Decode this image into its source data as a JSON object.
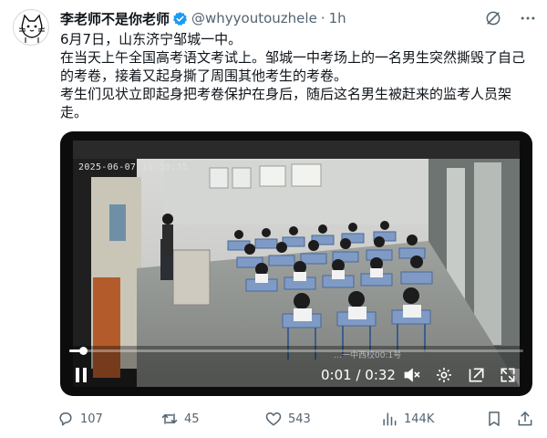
{
  "author": {
    "name": "李老师不是你老师",
    "handle": "@whyyoutouzhele",
    "separator": "·",
    "time": "1h",
    "avatar_icon": "cat-sketch-avatar",
    "verified_icon": "verified-badge-icon",
    "verified_color": "#1d9bf0"
  },
  "body": {
    "lines": [
      "6月7日，山东济宁邹城一中。",
      "在当天上午全国高考语文考试上。邹城一中考场上的一名男生突然撕毁了自己的考卷，接着又起身撕了周围其他考生的考卷。",
      "考生们见状立即起身把考卷保护在身后，随后这名男生被赶来的监考人员架走。"
    ]
  },
  "video": {
    "timestamp": "2025-06-07 10:38:35",
    "watermark": "…一中西校00:1号",
    "current_time": "0:01",
    "duration": "0:32",
    "time_separator": " / ",
    "progress": 0.03
  },
  "actions": {
    "reply": {
      "icon": "reply-icon",
      "count": "107"
    },
    "retweet": {
      "icon": "retweet-icon",
      "count": "45"
    },
    "like": {
      "icon": "heart-icon",
      "count": "543"
    },
    "views": {
      "icon": "views-chart-icon",
      "count": "144K"
    },
    "bookmark": {
      "icon": "bookmark-icon"
    },
    "share": {
      "icon": "share-icon"
    }
  },
  "colors": {
    "text": "#0f1419",
    "secondary": "#536471",
    "verified": "#1d9bf0"
  }
}
